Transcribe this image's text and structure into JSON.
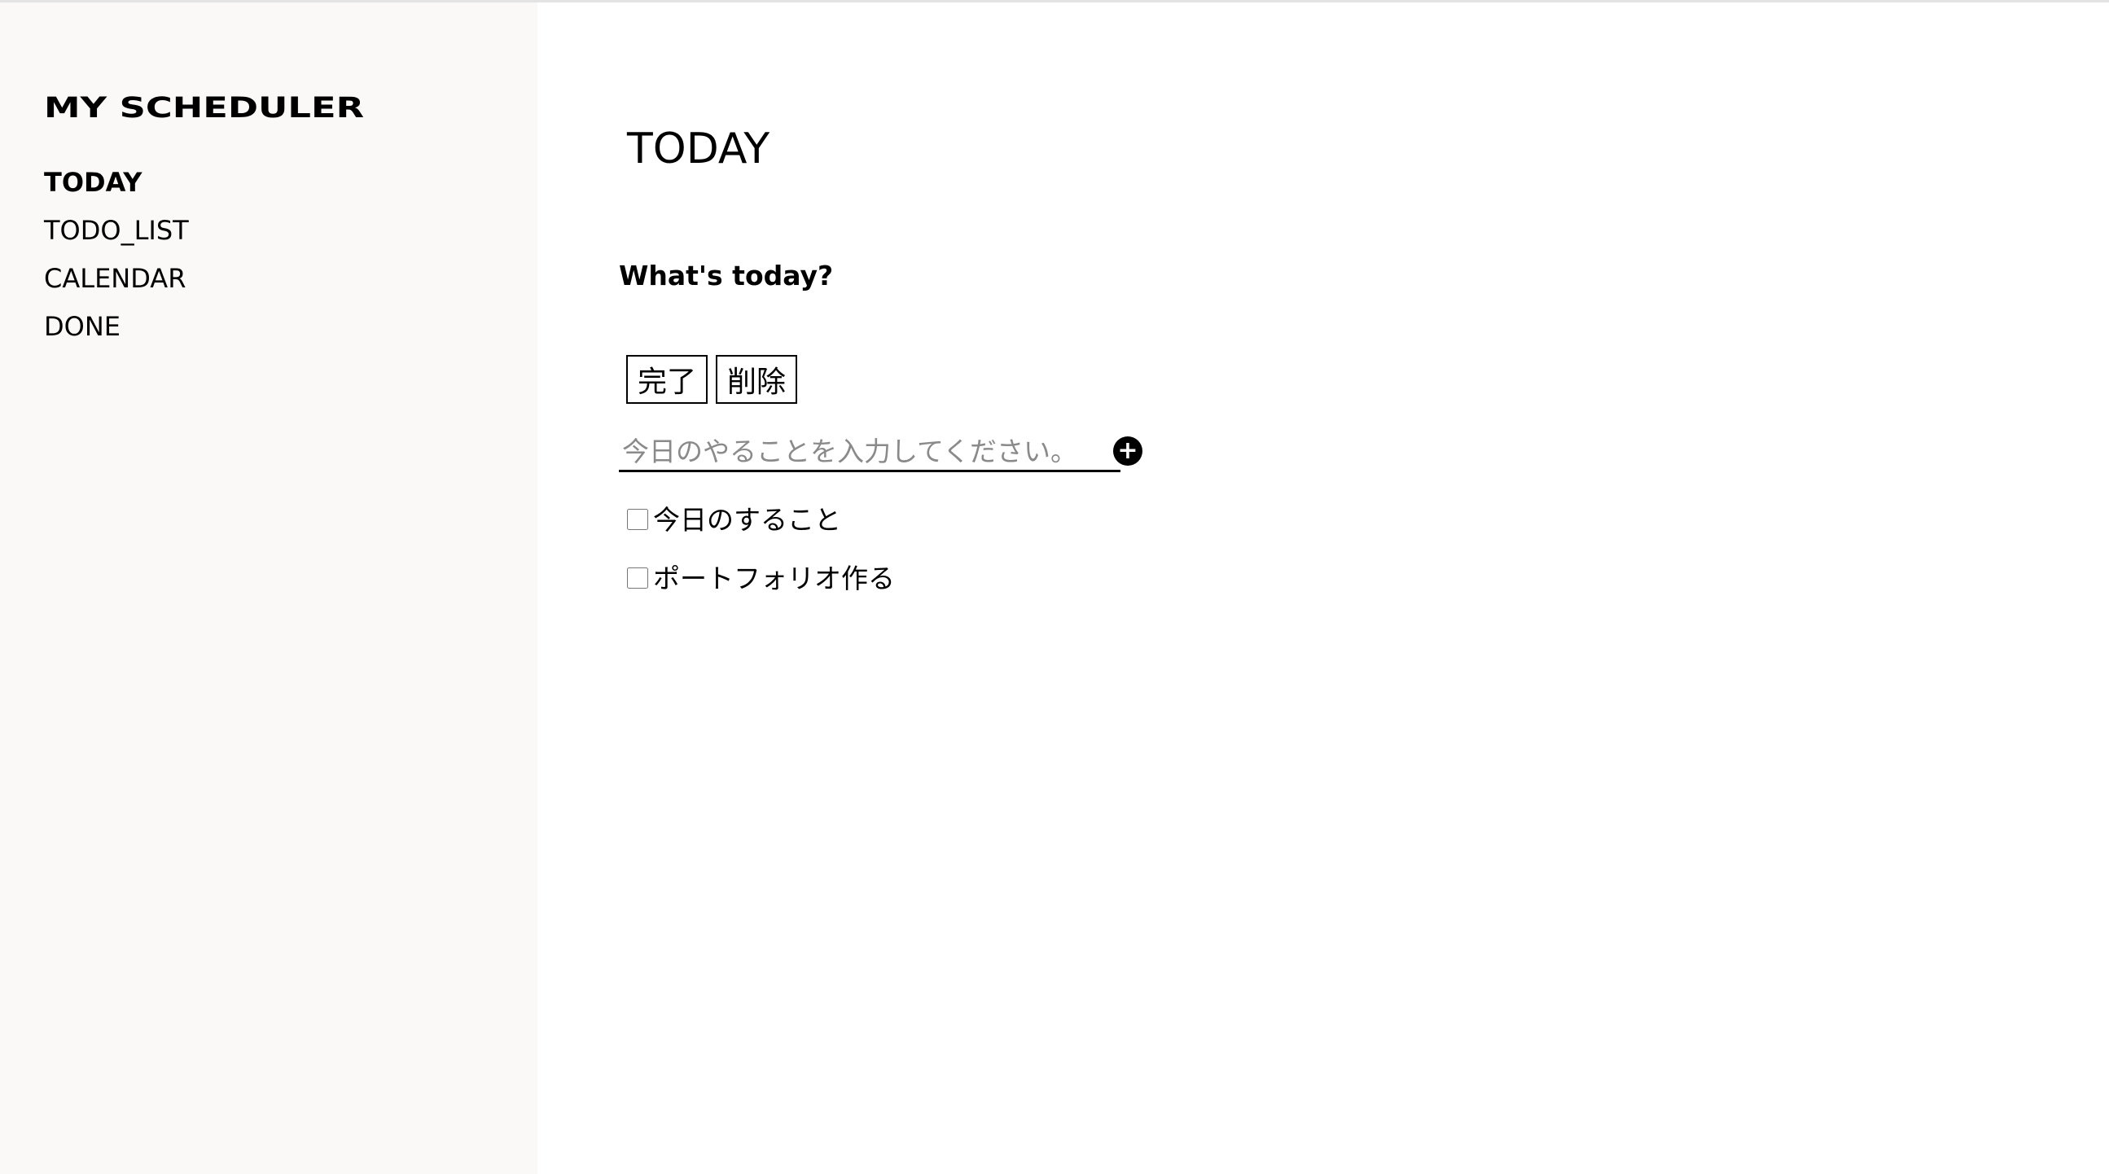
{
  "app": {
    "brand": "MY SCHEDULER"
  },
  "sidebar": {
    "items": [
      {
        "label": "TODAY",
        "active": true
      },
      {
        "label": "TODO_LIST",
        "active": false
      },
      {
        "label": "CALENDAR",
        "active": false
      },
      {
        "label": "DONE",
        "active": false
      }
    ]
  },
  "main": {
    "title": "TODAY",
    "prompt": "What's today?",
    "buttons": {
      "complete_label": "完了",
      "delete_label": "削除"
    },
    "input": {
      "value": "",
      "placeholder": "今日のやることを入力してください。"
    },
    "add_button": {
      "glyph": "+",
      "icon": "plus-circle-icon"
    },
    "tasks": [
      {
        "label": "今日のすること",
        "checked": false
      },
      {
        "label": "ポートフォリオ作る",
        "checked": false
      }
    ]
  }
}
